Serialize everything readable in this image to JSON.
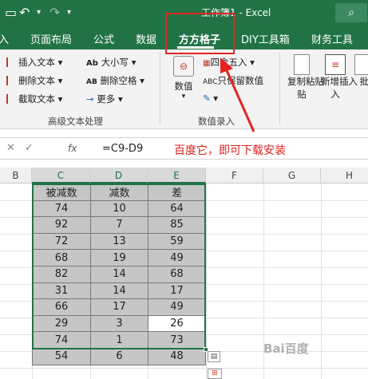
{
  "title": "工作簿1 - Excel",
  "tabs": [
    "入",
    "页面布局",
    "公式",
    "数据",
    "方方格子",
    "DIY工具箱",
    "财务工具"
  ],
  "active_tab": "方方格子",
  "ribbon": {
    "text_group": {
      "buttons": [
        "插入文本",
        "删除文本",
        "截取文本",
        "大小写",
        "删除空格",
        "更多"
      ],
      "label": "高级文本处理"
    },
    "entry_group": {
      "buttons": [
        "数值",
        "四舍五入",
        "只保留数值"
      ],
      "label": "数值录入"
    },
    "right_buttons": [
      "复制粘贴",
      "新增插入",
      "批量"
    ],
    "right_sub": [
      "贴",
      "入"
    ]
  },
  "formula_bar": {
    "formula": "=C9-D9",
    "annotation": "百度它，即可下载安装"
  },
  "columns": [
    "B",
    "C",
    "D",
    "E",
    "F",
    "G",
    "H"
  ],
  "table": {
    "headers": [
      "被减数",
      "减数",
      "差"
    ],
    "rows": [
      [
        "74",
        "10",
        "64"
      ],
      [
        "92",
        "7",
        "85"
      ],
      [
        "72",
        "13",
        "59"
      ],
      [
        "68",
        "19",
        "49"
      ],
      [
        "82",
        "14",
        "68"
      ],
      [
        "31",
        "14",
        "17"
      ],
      [
        "66",
        "17",
        "49"
      ],
      [
        "29",
        "3",
        "26"
      ],
      [
        "74",
        "1",
        "73"
      ],
      [
        "54",
        "6",
        "48"
      ]
    ]
  },
  "watermark": "Bai百度"
}
